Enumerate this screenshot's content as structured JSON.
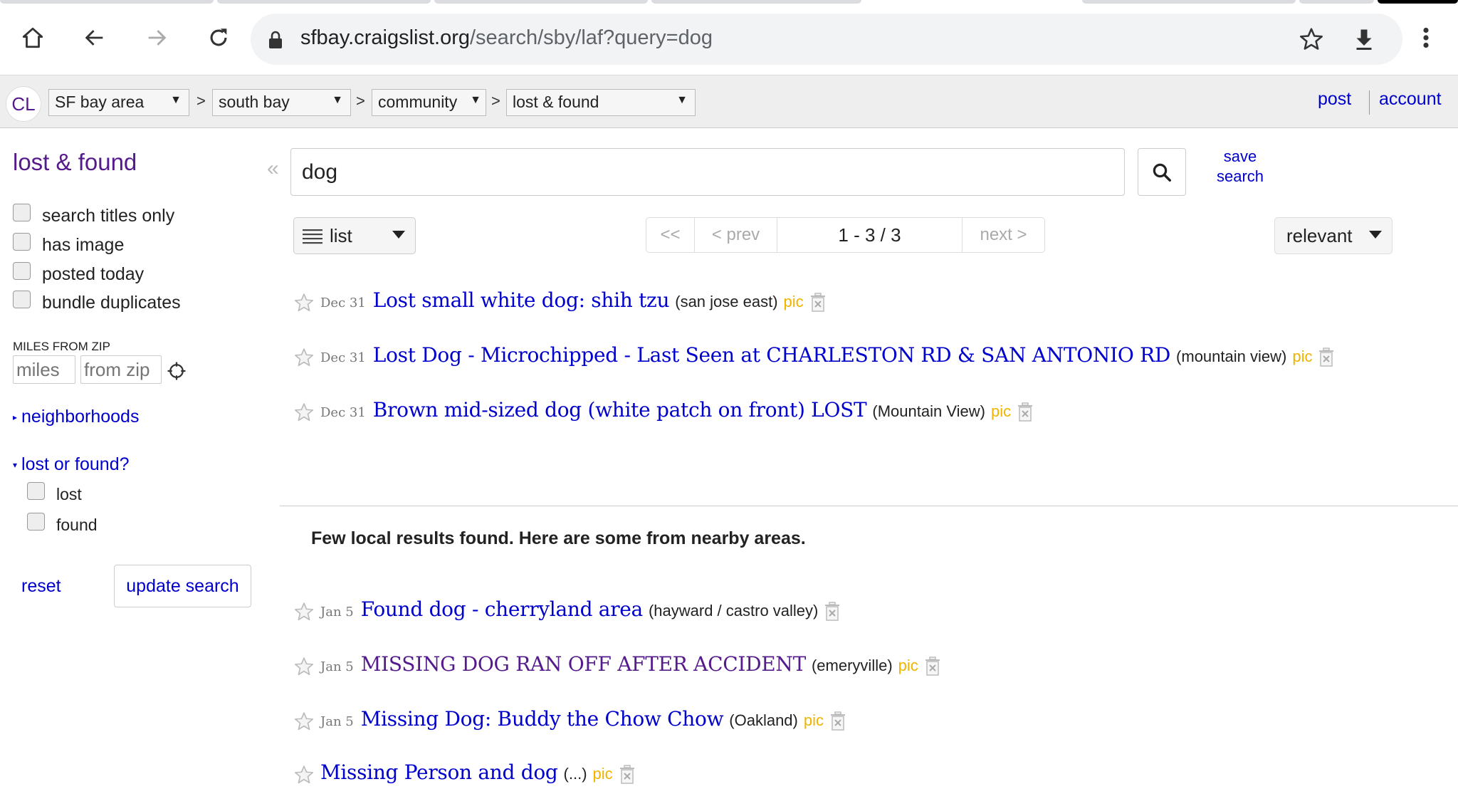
{
  "browser": {
    "url_host": "sfbay.craigslist.org",
    "url_path": "/search/sby/laf?query=dog",
    "icons": [
      "home-icon",
      "back-icon",
      "forward-icon",
      "reload-icon",
      "lock-icon",
      "bookmark-star-icon",
      "download-icon",
      "menu-dots-icon"
    ]
  },
  "header": {
    "logo": "CL",
    "breadcrumbs": [
      {
        "label": "SF bay area"
      },
      {
        "label": "south bay"
      },
      {
        "label": "community"
      },
      {
        "label": "lost & found"
      }
    ],
    "separator": ">",
    "post_link": "post",
    "account_link": "account"
  },
  "sidebar": {
    "title": "lost & found",
    "filters": [
      {
        "label": "search titles only",
        "checked": false
      },
      {
        "label": "has image",
        "checked": false
      },
      {
        "label": "posted today",
        "checked": false
      },
      {
        "label": "bundle duplicates",
        "checked": false
      }
    ],
    "miles_label": "MILES FROM ZIP",
    "miles_placeholder": "miles",
    "zip_placeholder": "from zip",
    "neighborhoods_label": "neighborhoods",
    "lost_or_found_label": "lost or found?",
    "lost_or_found_options": [
      {
        "label": "lost",
        "checked": false
      },
      {
        "label": "found",
        "checked": false
      }
    ],
    "reset_label": "reset",
    "update_label": "update search"
  },
  "search": {
    "collapse_glyph": "«",
    "query": "dog",
    "save_line1": "save",
    "save_line2": "search"
  },
  "controls": {
    "view_mode": "list",
    "pager": {
      "first": "<<",
      "prev": "< prev",
      "range": "1 - 3 / 3",
      "next": "next >"
    },
    "sort": "relevant"
  },
  "results": [
    {
      "date": "Dec 31",
      "title": "Lost small white dog: shih tzu",
      "hood": "(san jose east)",
      "pic": "pic",
      "visited": false
    },
    {
      "date": "Dec 31",
      "title": "Lost Dog - Microchipped - Last Seen at CHARLESTON RD & SAN ANTONIO RD",
      "hood": "(mountain view)",
      "pic": "pic",
      "visited": false
    },
    {
      "date": "Dec 31",
      "title": "Brown mid-sized dog (white patch on front) LOST",
      "hood": "(Mountain View)",
      "pic": "pic",
      "visited": false
    }
  ],
  "nearby_note": "Few local results found. Here are some from nearby areas.",
  "nearby_results": [
    {
      "date": "Jan 5",
      "title": "Found dog - cherryland area",
      "hood": "(hayward / castro valley)",
      "pic": "",
      "visited": false
    },
    {
      "date": "Jan 5",
      "title": "MISSING DOG RAN OFF AFTER ACCIDENT",
      "hood": "(emeryville)",
      "pic": "pic",
      "visited": true
    },
    {
      "date": "Jan 5",
      "title": "Missing Dog: Buddy the Chow Chow",
      "hood": "(Oakland)",
      "pic": "pic",
      "visited": false
    },
    {
      "date": "",
      "title": "Missing Person and dog",
      "hood": "(...)",
      "pic": "pic",
      "visited": false
    }
  ],
  "colors": {
    "link": "#0000cc",
    "visited": "#551a8b",
    "pic": "#f0b400"
  }
}
